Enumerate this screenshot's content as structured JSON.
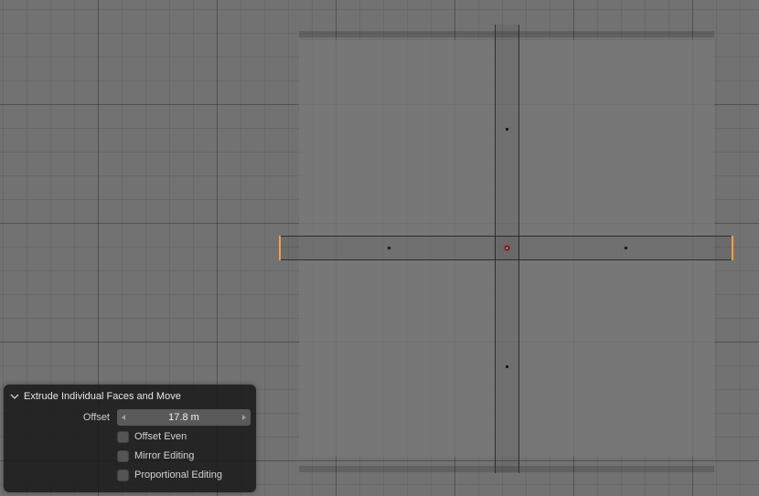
{
  "operator_panel": {
    "title": "Extrude Individual Faces and Move",
    "offset_label": "Offset",
    "offset_value": "17.8 m",
    "offset_even_label": "Offset Even",
    "offset_even_checked": false,
    "mirror_editing_label": "Mirror Editing",
    "mirror_editing_checked": false,
    "proportional_editing_label": "Proportional Editing",
    "proportional_editing_checked": false
  }
}
